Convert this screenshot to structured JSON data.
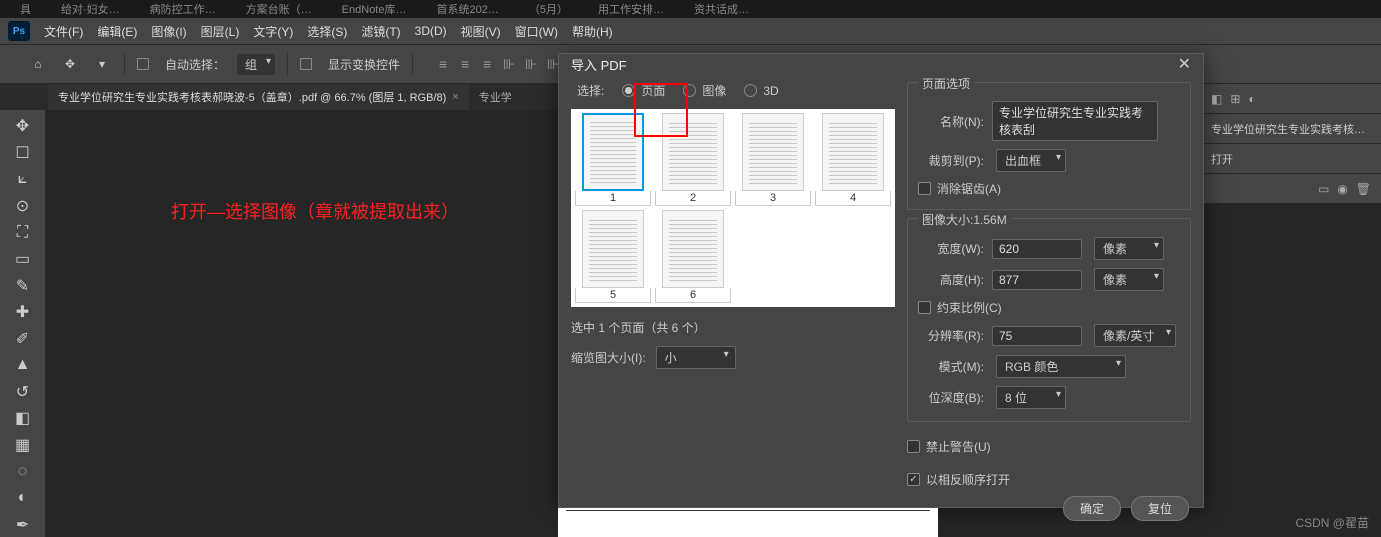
{
  "top_tabs": [
    "具",
    "给对·妇女…",
    "病防控工作…",
    "方案台账（…",
    "EndNote库…",
    "首系统202…",
    "（5月）",
    "用工作安排…",
    "资共话成…"
  ],
  "menu": {
    "file": "文件(F)",
    "edit": "编辑(E)",
    "image": "图像(I)",
    "layer": "图层(L)",
    "type": "文字(Y)",
    "select": "选择(S)",
    "filter": "滤镜(T)",
    "3d": "3D(D)",
    "view": "视图(V)",
    "window": "窗口(W)",
    "help": "帮助(H)"
  },
  "options": {
    "auto_select": "自动选择：",
    "group": "组",
    "show_transform": "显示变换控件"
  },
  "tabs": {
    "active": "专业学位研究生专业实践考核表郝晓波-5（盖章）.pdf @ 66.7% (图层 1, RGB/8)",
    "other": "专业学"
  },
  "annotation": "打开—选择图像（章就被提取出来）",
  "right_panel": {
    "row1": "专业学位研究生专业实践考核…",
    "row2": "打开"
  },
  "dialog": {
    "title": "导入 PDF",
    "select_label": "选择:",
    "radio_page": "页面",
    "radio_image": "图像",
    "radio_3d": "3D",
    "thumbs": [
      "1",
      "2",
      "3",
      "4",
      "5",
      "6"
    ],
    "status": "选中 1 个页面（共 6 个）",
    "thumb_size_label": "缩览图大小(I):",
    "thumb_size_value": "小",
    "page_options": "页面选项",
    "name_label": "名称(N):",
    "name_value": "专业学位研究生专业实践考核表刮",
    "crop_label": "裁剪到(P):",
    "crop_value": "出血框",
    "antialias": "消除锯齿(A)",
    "image_size": "图像大小:1.56M",
    "width_label": "宽度(W):",
    "width_value": "620",
    "width_unit": "像素",
    "height_label": "高度(H):",
    "height_value": "877",
    "height_unit": "像素",
    "constrain": "约束比例(C)",
    "resolution_label": "分辨率(R):",
    "resolution_value": "75",
    "resolution_unit": "像素/英寸",
    "mode_label": "模式(M):",
    "mode_value": "RGB 颜色",
    "bitdepth_label": "位深度(B):",
    "bitdepth_value": "8 位",
    "suppress_warnings": "禁止警告(U)",
    "reverse_order": "以相反顺序打开",
    "ok": "确定",
    "reset": "复位"
  },
  "watermark": "CSDN @翟苗"
}
